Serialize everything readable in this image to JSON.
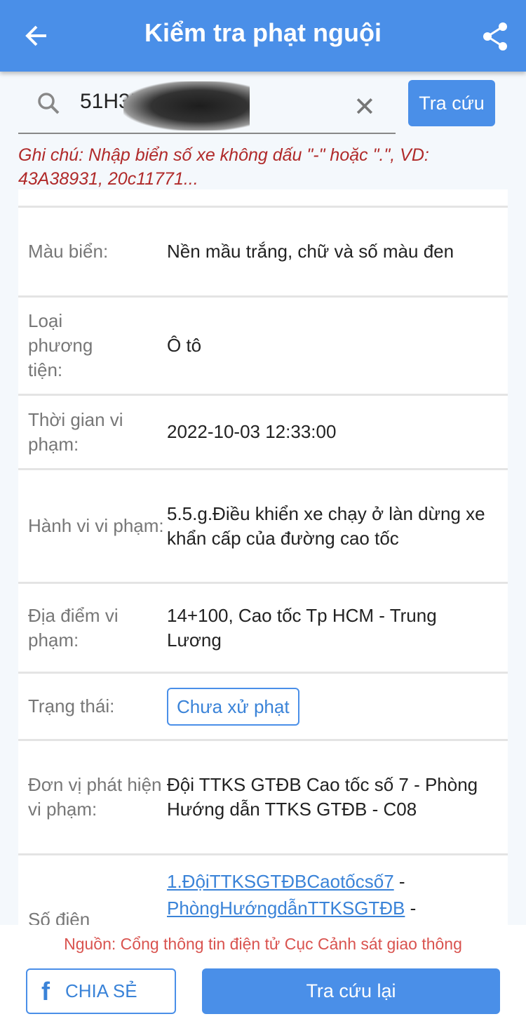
{
  "header": {
    "title": "Kiểm tra phạt nguội",
    "accent": "#4a8fe8"
  },
  "search": {
    "value": "51H35",
    "clear_icon": "close-icon",
    "button": "Tra cứu"
  },
  "note": "Ghi chú: Nhập biển số xe không dấu \"-\" hoặc \".\", VD: 43A38931, 20c11771...",
  "rows": [
    {
      "label": "Màu biển:",
      "value": "Nền mầu trắng, chữ và số màu đen"
    },
    {
      "label": "Loại phương tiện:",
      "value": "Ô tô"
    },
    {
      "label": "Thời gian vi phạm:",
      "value": "2022-10-03 12:33:00"
    },
    {
      "label": "Hành vi vi phạm:",
      "value": "5.5.g.Điều khiển xe chạy ở làn dừng xe khẩn cấp của đường cao tốc"
    },
    {
      "label": "Địa điểm vi phạm:",
      "value": "14+100, Cao tốc Tp HCM - Trung Lương"
    },
    {
      "label": "Trạng thái:",
      "value": "Chưa xử phạt"
    },
    {
      "label": "Đơn vị phát hiện vi phạm:",
      "value": "Đội TTKS GTĐB Cao tốc số 7 - Phòng Hướng dẫn TTKS GTĐB - C08"
    },
    {
      "label": "Số điện",
      "links": [
        "1.ĐộiTTKSGTĐBCaotốcsố7",
        "PhòngHướngdẫnTTKSGTĐB"
      ],
      "sep": " -"
    }
  ],
  "footer": {
    "source": "Nguồn: Cổng thông tin điện tử Cục Cảnh sát giao thông",
    "share": "CHIA SẺ",
    "again": "Tra cứu lại"
  }
}
